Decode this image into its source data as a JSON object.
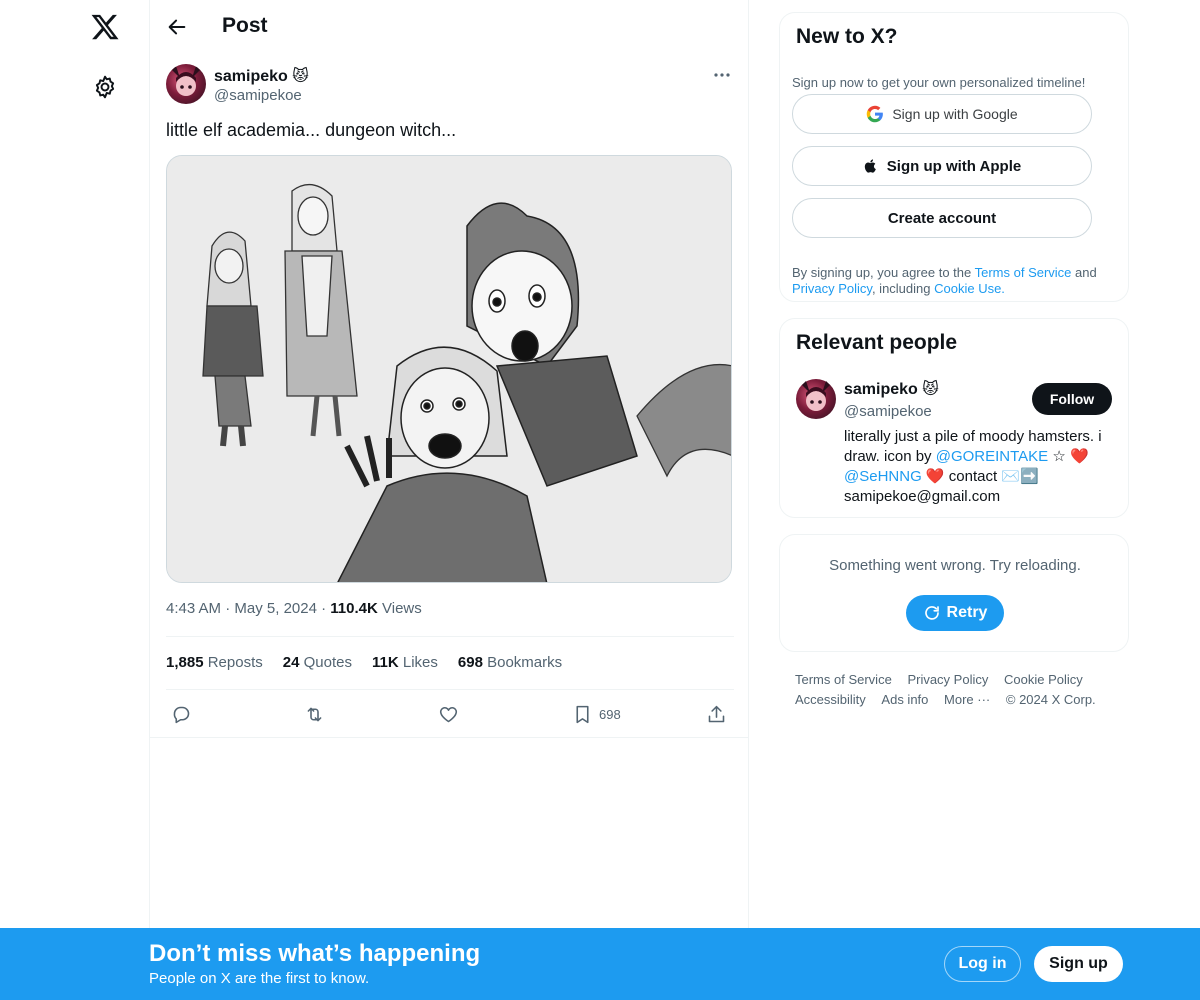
{
  "header": {
    "title": "Post"
  },
  "post": {
    "author_name": "samipeko",
    "author_emoji": "😾",
    "author_handle": "@samipekoe",
    "text": "little elf academia... dungeon witch...",
    "time": "4:43 AM",
    "date": "May 5, 2024",
    "views_count": "110.4K",
    "views_label": "Views",
    "stats": [
      {
        "count": "1,885",
        "label": "Reposts"
      },
      {
        "count": "24",
        "label": "Quotes"
      },
      {
        "count": "11K",
        "label": "Likes"
      },
      {
        "count": "698",
        "label": "Bookmarks"
      }
    ],
    "bookmark_count": "698",
    "image_alt": "Ink illustration of four anime characters: two standing women on the left, a shocked girl with a ponytail and a screaming elf-eared girl on the right"
  },
  "signup_card": {
    "title": "New to X?",
    "subtitle": "Sign up now to get your own personalized timeline!",
    "google_label": "Sign up with Google",
    "apple_label": "Sign up with Apple",
    "create_label": "Create account",
    "legal_prefix": "By signing up, you agree to the ",
    "terms_link": "Terms of Service",
    "legal_and": " and ",
    "privacy_link": "Privacy Policy",
    "legal_mid": ", including ",
    "cookie_link": "Cookie Use."
  },
  "relevant": {
    "title": "Relevant people",
    "name": "samipeko",
    "emoji": "😾",
    "handle": "@samipekoe",
    "follow_label": "Follow",
    "bio_1": "literally just a pile of moody hamsters. i draw. icon by ",
    "bio_link_1": "@GOREINTAKE",
    "bio_2": " ☆ ❤️ ",
    "bio_link_2": "@SeHNNG",
    "bio_3": " ❤️ contact ✉️➡️ samipekoe@gmail.com"
  },
  "error_card": {
    "message": "Something went wrong. Try reloading.",
    "retry_label": "Retry"
  },
  "footer": {
    "links": [
      "Terms of Service",
      "Privacy Policy",
      "Cookie Policy",
      "Accessibility",
      "Ads info",
      "More ···",
      "© 2024 X Corp."
    ]
  },
  "banner": {
    "title": "Don’t miss what’s happening",
    "subtitle": "People on X are the first to know.",
    "login_label": "Log in",
    "signup_label": "Sign up"
  },
  "colors": {
    "accent": "#1d9bf0",
    "text": "#0f1419",
    "muted": "#536471"
  }
}
